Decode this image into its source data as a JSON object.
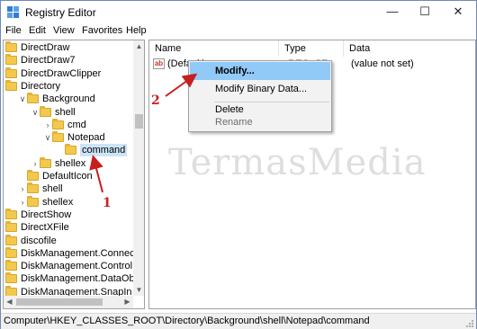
{
  "window": {
    "title": "Registry Editor"
  },
  "menu": [
    "File",
    "Edit",
    "View",
    "Favorites",
    "Help"
  ],
  "tree": [
    {
      "label": "DirectDraw",
      "chevron": ""
    },
    {
      "label": "DirectDraw7",
      "chevron": ""
    },
    {
      "label": "DirectDrawClipper",
      "chevron": ""
    },
    {
      "label": "Directory",
      "chevron": "v"
    },
    {
      "label": "Background",
      "chevron": "v"
    },
    {
      "label": "shell",
      "chevron": "v"
    },
    {
      "label": "cmd",
      "chevron": ">"
    },
    {
      "label": "Notepad",
      "chevron": "v"
    },
    {
      "label": "command",
      "chevron": "",
      "selected": true
    },
    {
      "label": "shellex",
      "chevron": ">"
    },
    {
      "label": "DefaultIcon",
      "chevron": ""
    },
    {
      "label": "shell",
      "chevron": ">"
    },
    {
      "label": "shellex",
      "chevron": ">"
    },
    {
      "label": "DirectShow",
      "chevron": ""
    },
    {
      "label": "DirectXFile",
      "chevron": ""
    },
    {
      "label": "discofile",
      "chevron": ""
    },
    {
      "label": "DiskManagement.Connection",
      "chevron": ""
    },
    {
      "label": "DiskManagement.Control",
      "chevron": ""
    },
    {
      "label": "DiskManagement.DataObject",
      "chevron": ""
    },
    {
      "label": "DiskManagement.SnapIn",
      "chevron": ""
    }
  ],
  "columns": {
    "name": "Name",
    "type": "Type",
    "data": "Data"
  },
  "values": [
    {
      "name": "(Default)",
      "type": "REG_SZ",
      "data": "(value not set)"
    }
  ],
  "context_menu": {
    "items": [
      {
        "label": "Modify...",
        "highlighted": true
      },
      {
        "label": "Modify Binary Data...",
        "highlighted": false
      },
      {
        "label": "Delete",
        "highlighted": false
      },
      {
        "label": "Rename",
        "disabled": true
      }
    ]
  },
  "status": {
    "path": "Computer\\HKEY_CLASSES_ROOT\\Directory\\Background\\shell\\Notepad\\command"
  },
  "watermark": "TermasMedia",
  "annotations": {
    "step1": "1",
    "step2": "2",
    "color": "#c81e1e"
  }
}
